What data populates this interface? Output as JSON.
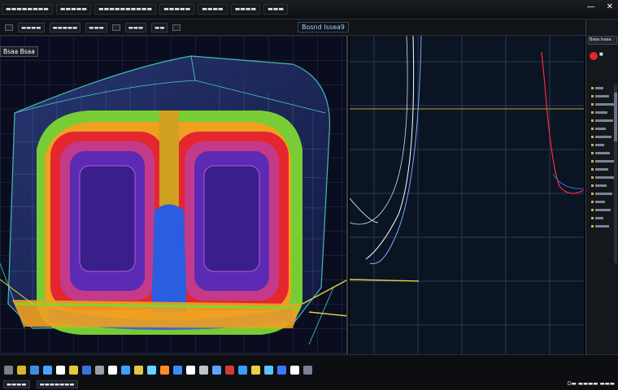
{
  "menubar": {
    "items": [
      "▬▬▬▬▬▬▬▬",
      "▬▬▬▬▬",
      "▬▬▬▬▬▬▬▬▬▬",
      "▬▬▬▬▬",
      "▬▬▬▬",
      "▬▬▬▬",
      "▬▬▬"
    ],
    "controls": [
      "—",
      "✕"
    ]
  },
  "toolbar": {
    "items": [
      "▬▬▬▬",
      "▬▬▬▬▬",
      "▬▬▬",
      "▬▬▬",
      "▬▬"
    ],
    "viewport_title": "Bosnd Issea9"
  },
  "viewport": {
    "label": "Bsaa Bsaa",
    "colors": {
      "outer": "#40d0a0",
      "green": "#7dd633",
      "red": "#e4262e",
      "purple": "#5d2bb3",
      "blue": "#2b5de0"
    }
  },
  "plot": {
    "curves": [
      "#ffffff",
      "#7fa5ff",
      "#c8e6ff"
    ],
    "right_curve_color": "#ff2a3b"
  },
  "properties": {
    "header": "Bsea Issea",
    "badge": "■",
    "rows": 18
  },
  "bottombar": {
    "icons": [
      "#7a7f8a",
      "#d6b42e",
      "#3a8fe0",
      "#4aa3ff",
      "#ffffff",
      "#e6c83a",
      "#3a72d8",
      "#9aa0ab",
      "#ffffff",
      "#3ba0ff",
      "#e2c744",
      "#6ad2ff",
      "#ff8a2a",
      "#3c8bff",
      "#ffffff",
      "#c0c4cc",
      "#5aa3ff",
      "#d43a3a",
      "#3a9bff",
      "#e7d04a",
      "#58c3ff",
      "#3c79ff",
      "#ffffff",
      "#7b8190"
    ],
    "status_left": "▬▬▬▬",
    "status_mid": "▬▬▬▬▬▬▬",
    "clock": "D▬ ▬▬▬▬ ▬▬▬"
  }
}
